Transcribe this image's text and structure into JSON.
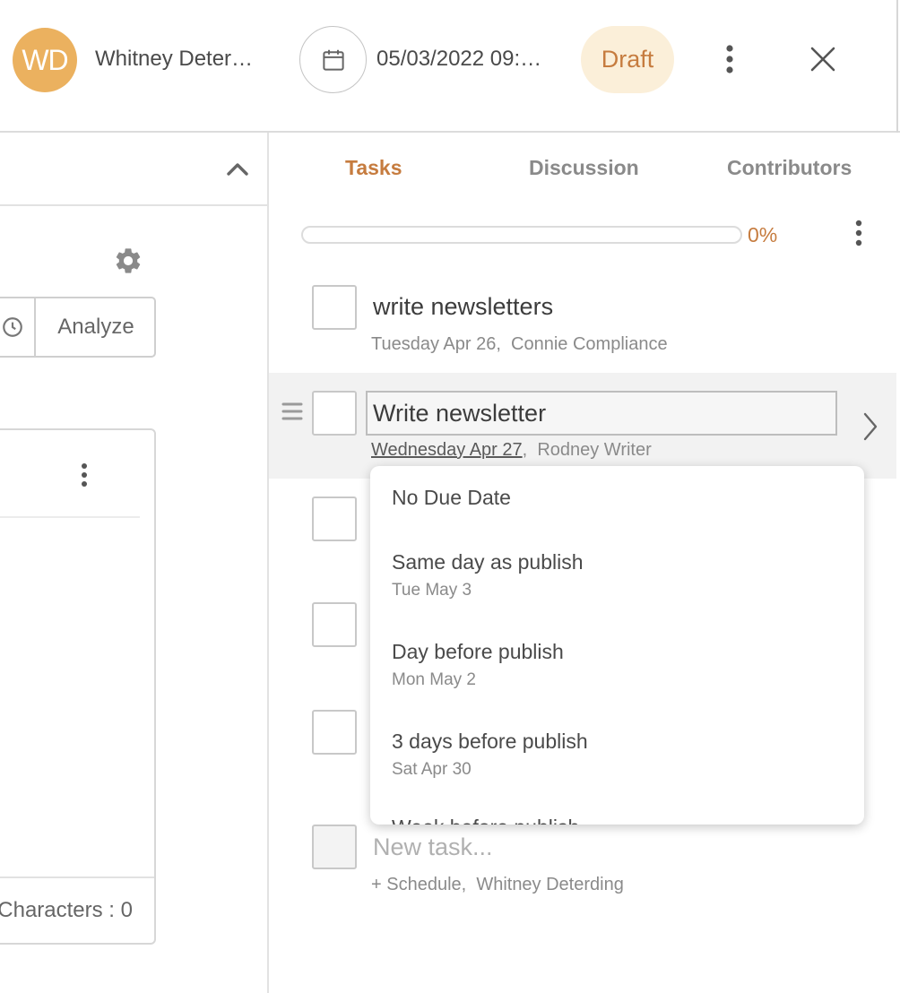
{
  "header": {
    "avatar_initials": "WD",
    "author_name": "Whitney Deter…",
    "publish_datetime": "05/03/2022 09:…",
    "status": "Draft",
    "icons": {
      "calendar": "calendar-icon",
      "more": "more-vertical-icon",
      "close": "close-icon"
    }
  },
  "left_panel": {
    "analyze_label": "Analyze",
    "characters_label": "Characters : 0",
    "icons": {
      "collapse": "chevron-up-icon",
      "settings": "gear-icon",
      "history": "history-icon",
      "more": "more-vertical-icon"
    }
  },
  "tabs": [
    {
      "label": "Tasks",
      "active": true
    },
    {
      "label": "Discussion",
      "active": false
    },
    {
      "label": "Contributors",
      "active": false
    }
  ],
  "progress": {
    "value": 0,
    "label": "0%"
  },
  "tasks": [
    {
      "title": "write newsletters",
      "due": "Tuesday Apr 26",
      "assignee": "Connie Compliance"
    },
    {
      "title": "Write newsletter",
      "due": "Wednesday Apr 27",
      "assignee": "Rodney Writer",
      "selected": true
    }
  ],
  "due_date_menu": {
    "options": [
      {
        "label": "No Due Date",
        "sub": ""
      },
      {
        "label": "Same day as publish",
        "sub": "Tue May 3"
      },
      {
        "label": "Day before publish",
        "sub": "Mon May 2"
      },
      {
        "label": "3 days before publish",
        "sub": "Sat Apr 30"
      },
      {
        "label": "Week before publish",
        "sub": ""
      }
    ]
  },
  "new_task": {
    "placeholder": "New task...",
    "schedule_label": "+ Schedule",
    "assignee": "Whitney Deterding"
  },
  "colors": {
    "accent": "#c67c3f",
    "avatar": "#ebb15f",
    "badge_bg": "#fbefd9"
  }
}
